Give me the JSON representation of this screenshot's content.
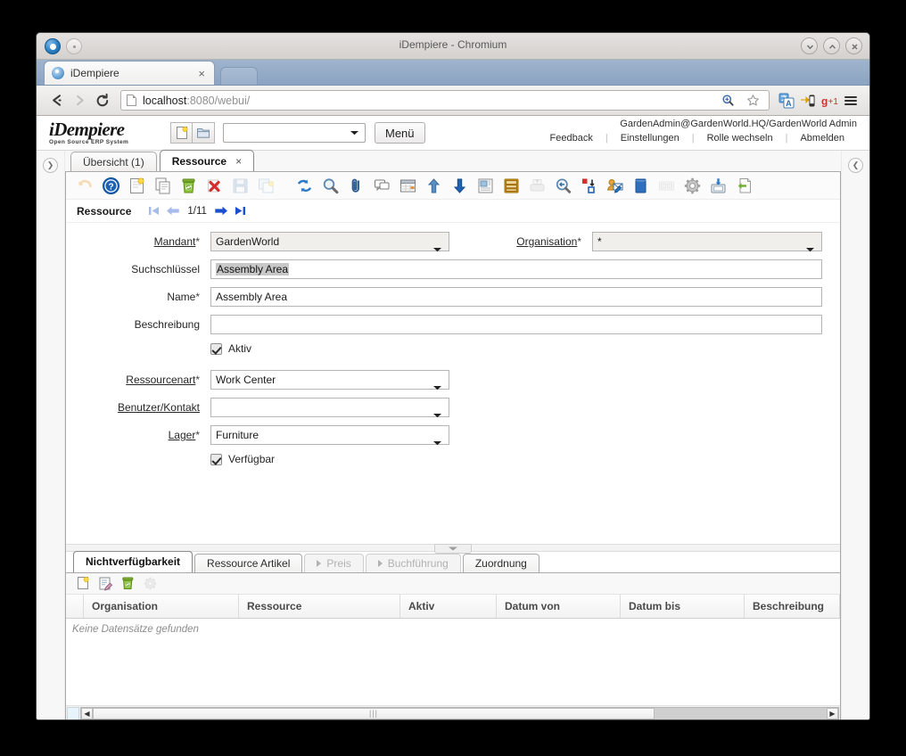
{
  "window": {
    "title": "iDempiere - Chromium",
    "controls": [
      "minimize",
      "maximize",
      "close"
    ]
  },
  "browser": {
    "tab": {
      "label": "iDempiere",
      "close": "×"
    },
    "url": {
      "host": "localhost",
      "rest": ":8080/webui/"
    },
    "nav": {
      "back": "back-arrow",
      "forward": "forward-arrow",
      "reload": "reload"
    },
    "omnibox_icons": [
      "zoom-icon",
      "bookmark-star-icon",
      "translate-icon",
      "mobile-icon",
      "gplus-icon",
      "menu-icon"
    ]
  },
  "app": {
    "logo_line1": "iDempiere",
    "logo_line2": "Open Source  ERP System",
    "new_icon": "new-document-icon",
    "open_icon": "open-folder-icon",
    "search_select_value": "",
    "menu_button": "Menü",
    "user_line": "GardenAdmin@GardenWorld.HQ/GardenWorld Admin",
    "links": [
      "Feedback",
      "Einstellungen",
      "Rolle wechseln",
      "Abmelden"
    ]
  },
  "window_tabs": [
    {
      "label": "Übersicht (1)",
      "active": false,
      "closable": false
    },
    {
      "label": "Ressource",
      "active": true,
      "closable": true,
      "close": "×"
    }
  ],
  "toolbar": {
    "items": [
      {
        "name": "undo-icon",
        "disabled": true
      },
      {
        "name": "help-icon",
        "disabled": false
      },
      {
        "name": "new-record-icon",
        "disabled": false
      },
      {
        "name": "copy-record-icon",
        "disabled": false
      },
      {
        "name": "delete-record-icon",
        "disabled": false
      },
      {
        "name": "delete-selection-icon",
        "disabled": false
      },
      {
        "name": "save-icon",
        "disabled": true
      },
      {
        "name": "save-create-new-icon",
        "disabled": true
      },
      {
        "name": "refresh-icon",
        "disabled": false
      },
      {
        "name": "find-icon",
        "disabled": false
      },
      {
        "name": "attachment-icon",
        "disabled": false
      },
      {
        "name": "chat-icon",
        "disabled": false
      },
      {
        "name": "grid-toggle-icon",
        "disabled": false
      },
      {
        "name": "parent-record-icon",
        "disabled": false
      },
      {
        "name": "detail-record-icon",
        "disabled": false
      },
      {
        "name": "report-icon",
        "disabled": false
      },
      {
        "name": "archive-icon",
        "disabled": false
      },
      {
        "name": "print-icon",
        "disabled": true
      },
      {
        "name": "print-preview-icon",
        "disabled": false
      },
      {
        "name": "zoom-across-icon",
        "disabled": false
      },
      {
        "name": "request-icon",
        "disabled": false
      },
      {
        "name": "product-info-icon",
        "disabled": false
      },
      {
        "name": "customize-icon",
        "disabled": true
      },
      {
        "name": "process-gear-icon",
        "disabled": false
      },
      {
        "name": "export-icon",
        "disabled": false
      },
      {
        "name": "exit-icon",
        "disabled": false
      }
    ]
  },
  "record_nav": {
    "label": "Ressource",
    "first": "first-record-icon",
    "prev": "previous-record-icon",
    "counter": "1/11",
    "next": "next-record-icon",
    "last": "last-record-icon"
  },
  "form": {
    "fields": [
      {
        "label": "Mandant",
        "required": true,
        "underline": true,
        "type": "select",
        "value": "GardenWorld",
        "col": "left",
        "readonly_bg": true
      },
      {
        "label": "Organisation",
        "required": true,
        "underline": true,
        "type": "select",
        "value": "*",
        "col": "right",
        "readonly_bg": true
      },
      {
        "label": "Suchschlüssel",
        "required": false,
        "underline": false,
        "type": "text-selected",
        "value": "Assembly Area",
        "col": "full"
      },
      {
        "label": "Name",
        "required": true,
        "underline": false,
        "type": "text",
        "value": "Assembly Area",
        "col": "full"
      },
      {
        "label": "Beschreibung",
        "required": false,
        "underline": false,
        "type": "text",
        "value": "",
        "col": "full"
      },
      {
        "label": "Aktiv",
        "required": false,
        "type": "checkbox",
        "checked": true
      },
      {
        "label": "Ressourcenart",
        "required": true,
        "underline": true,
        "type": "select",
        "value": "Work Center",
        "col": "left",
        "readonly_bg": false
      },
      {
        "label": "Benutzer/Kontakt",
        "required": false,
        "underline": true,
        "type": "select",
        "value": "",
        "col": "left",
        "readonly_bg": false
      },
      {
        "label": "Lager",
        "required": true,
        "underline": true,
        "type": "select",
        "value": "Furniture",
        "col": "left",
        "readonly_bg": false
      },
      {
        "label": "Verfügbar",
        "required": false,
        "type": "checkbox",
        "checked": true
      }
    ]
  },
  "lower_tabs": [
    {
      "label": "Nichtverfügbarkeit",
      "active": true,
      "disabled": false
    },
    {
      "label": "Ressource Artikel",
      "active": false,
      "disabled": false
    },
    {
      "label": "Preis",
      "active": false,
      "disabled": true
    },
    {
      "label": "Buchführung",
      "active": false,
      "disabled": true
    },
    {
      "label": "Zuordnung",
      "active": false,
      "disabled": false
    }
  ],
  "grid": {
    "toolbar": [
      "new-record-icon",
      "edit-record-icon",
      "delete-record-icon",
      "customize-icon"
    ],
    "columns": [
      "Organisation",
      "Ressource",
      "Aktiv",
      "Datum von",
      "Datum bis",
      "Beschreibung"
    ],
    "rows": [],
    "empty_message": "Keine Datensätze gefunden",
    "scroll_left_arrow": "◀",
    "scroll_right_arrow": "▶",
    "scroll_grip": "|||"
  },
  "rails": {
    "left_collapse": "❯",
    "right_collapse": "❮"
  },
  "colors": {
    "accent_blue": "#1b4fd0",
    "titlebar": "#d4d1ce",
    "tabstrip": "#8ba4c2",
    "field_readonly": "#f0efec",
    "selection": "#c8c8c8"
  }
}
